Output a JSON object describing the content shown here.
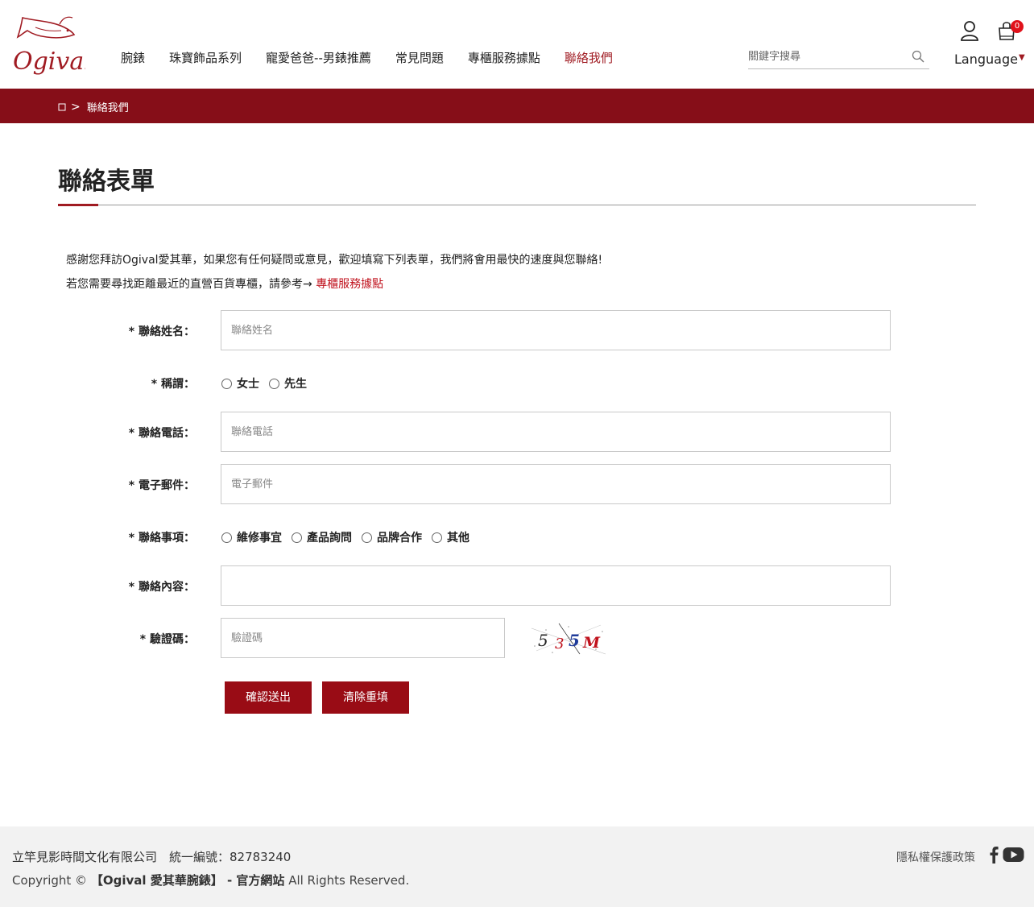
{
  "brand": {
    "logo_text": "Ogival",
    "accent": "#a01b22"
  },
  "nav": {
    "items": [
      {
        "label": "腕錶"
      },
      {
        "label": "珠寶飾品系列"
      },
      {
        "label": "寵愛爸爸--男錶推薦"
      },
      {
        "label": "常見問題"
      },
      {
        "label": "專櫃服務據點"
      },
      {
        "label": "聯絡我們",
        "active": true
      }
    ]
  },
  "search": {
    "placeholder": "關鍵字搜尋",
    "icon": "search-icon"
  },
  "cart": {
    "count": "0"
  },
  "language": {
    "label": "Language",
    "caret": "▼"
  },
  "breadcrumb": {
    "home_icon": "home-icon",
    "separator": ">",
    "current": "聯絡我們"
  },
  "page": {
    "title": "聯絡表單"
  },
  "intro": {
    "line1": "感謝您拜訪Ogival愛其華，如果您有任何疑問或意見，歡迎填寫下列表單，我們將會用最快的速度與您聯絡!",
    "line2_prefix": "若您需要尋找距離最近的直營百貨專櫃，請參考→ ",
    "line2_link": "專櫃服務據點"
  },
  "form": {
    "name": {
      "label": "* 聯絡姓名：",
      "placeholder": "聯絡姓名",
      "value": ""
    },
    "title": {
      "label": "* 稱謂：",
      "options": [
        "女士",
        "先生"
      ]
    },
    "phone": {
      "label": "* 聯絡電話：",
      "placeholder": "聯絡電話",
      "value": ""
    },
    "email": {
      "label": "* 電子郵件：",
      "placeholder": "電子郵件",
      "value": ""
    },
    "topic": {
      "label": "* 聯絡事項：",
      "options": [
        "維修事宜",
        "產品詢問",
        "品牌合作",
        "其他"
      ]
    },
    "content": {
      "label": "* 聯絡內容：",
      "value": ""
    },
    "captcha": {
      "label": "* 驗證碼：",
      "placeholder": "驗證碼",
      "code": "535M"
    },
    "submit_label": "確認送出",
    "reset_label": "清除重填"
  },
  "footer": {
    "company": "立竿見影時間文化有限公司　統一編號：82783240",
    "copyright_prefix": "Copyright © ",
    "copyright_brand": "【Ogival 愛其華腕錶】 - 官方網站",
    "copyright_suffix": " All Rights Reserved.",
    "privacy": "隱私權保護政策"
  }
}
